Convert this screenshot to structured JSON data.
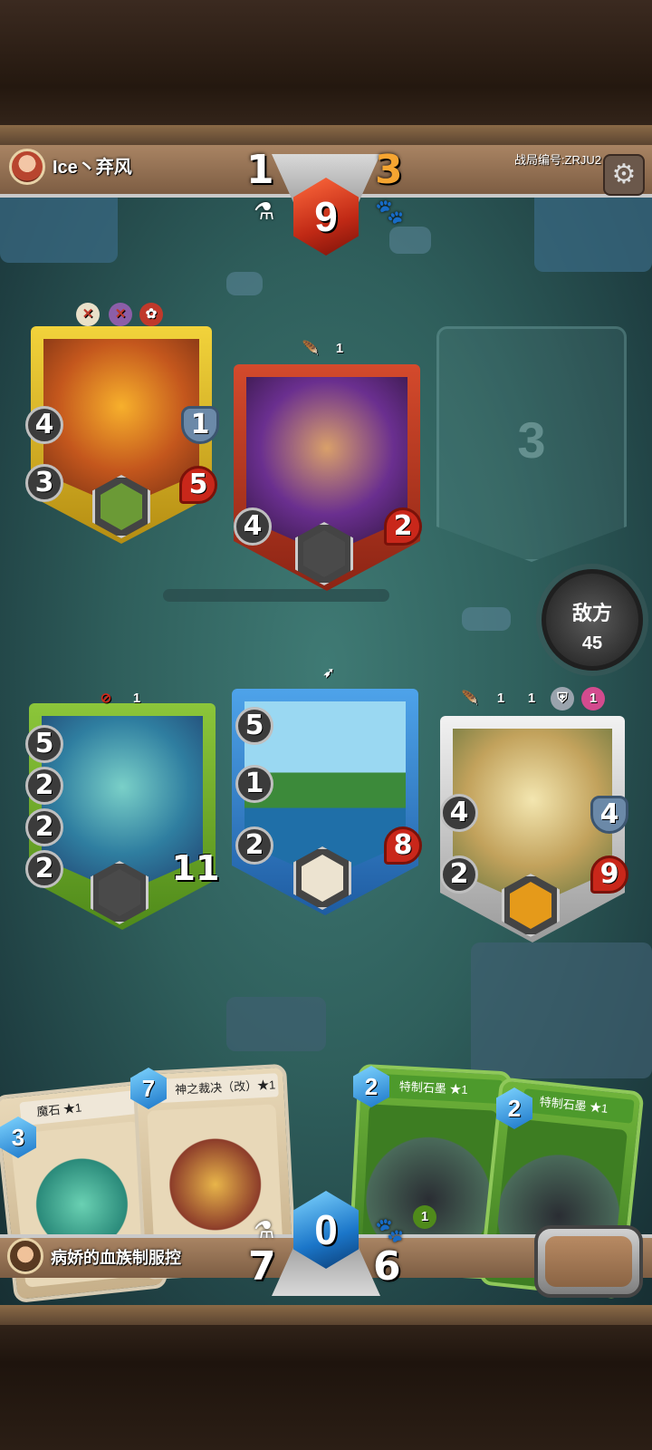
{
  "top_player": {
    "name": "Ice丶弃风",
    "potions": "1",
    "paws": "3",
    "energy": "9"
  },
  "game_id": "战局编号:ZRJU2",
  "settings": {
    "icon": "gear-icon"
  },
  "enemy_button": {
    "label": "敌方",
    "count": "45"
  },
  "empty_slot": {
    "number": "3"
  },
  "enemy_units": [
    {
      "name": "samurai-cat",
      "attack": "4",
      "armor": "1",
      "move": "3",
      "hp": "5",
      "frame_color": "#e0b825"
    },
    {
      "name": "purple-mage",
      "tag_value": "1",
      "attack": "4",
      "hp": "2",
      "frame_color": "#c2412a"
    }
  ],
  "ally_units": [
    {
      "name": "sea-queen",
      "tag_value": "1",
      "stats": [
        "5",
        "2",
        "2",
        "2"
      ],
      "hp": "11",
      "frame_color": "#7eb72f"
    },
    {
      "name": "island-turtle",
      "stats": [
        "5",
        "1",
        "2"
      ],
      "hp": "8",
      "frame_color": "#3d8ad6"
    },
    {
      "name": "dragon",
      "tag_values": [
        "1",
        "1",
        "1"
      ],
      "stats": [
        "4",
        "2"
      ],
      "armor": "4",
      "hp": "9",
      "frame_color": "#d8d8d8"
    }
  ],
  "hand": [
    {
      "title": "魔石 ★1",
      "cost": "3",
      "color": "tan"
    },
    {
      "title": "神之裁决（改）★1",
      "cost": "7",
      "color": "tan"
    },
    {
      "title": "特制石墨 ★1",
      "cost": "2",
      "color": "green",
      "badge": "1"
    },
    {
      "title": "特制石墨 ★1",
      "cost": "2",
      "color": "green"
    }
  ],
  "bottom_player": {
    "name": "病娇的血族制服控",
    "potions": "7",
    "paws": "6",
    "energy": "0"
  }
}
